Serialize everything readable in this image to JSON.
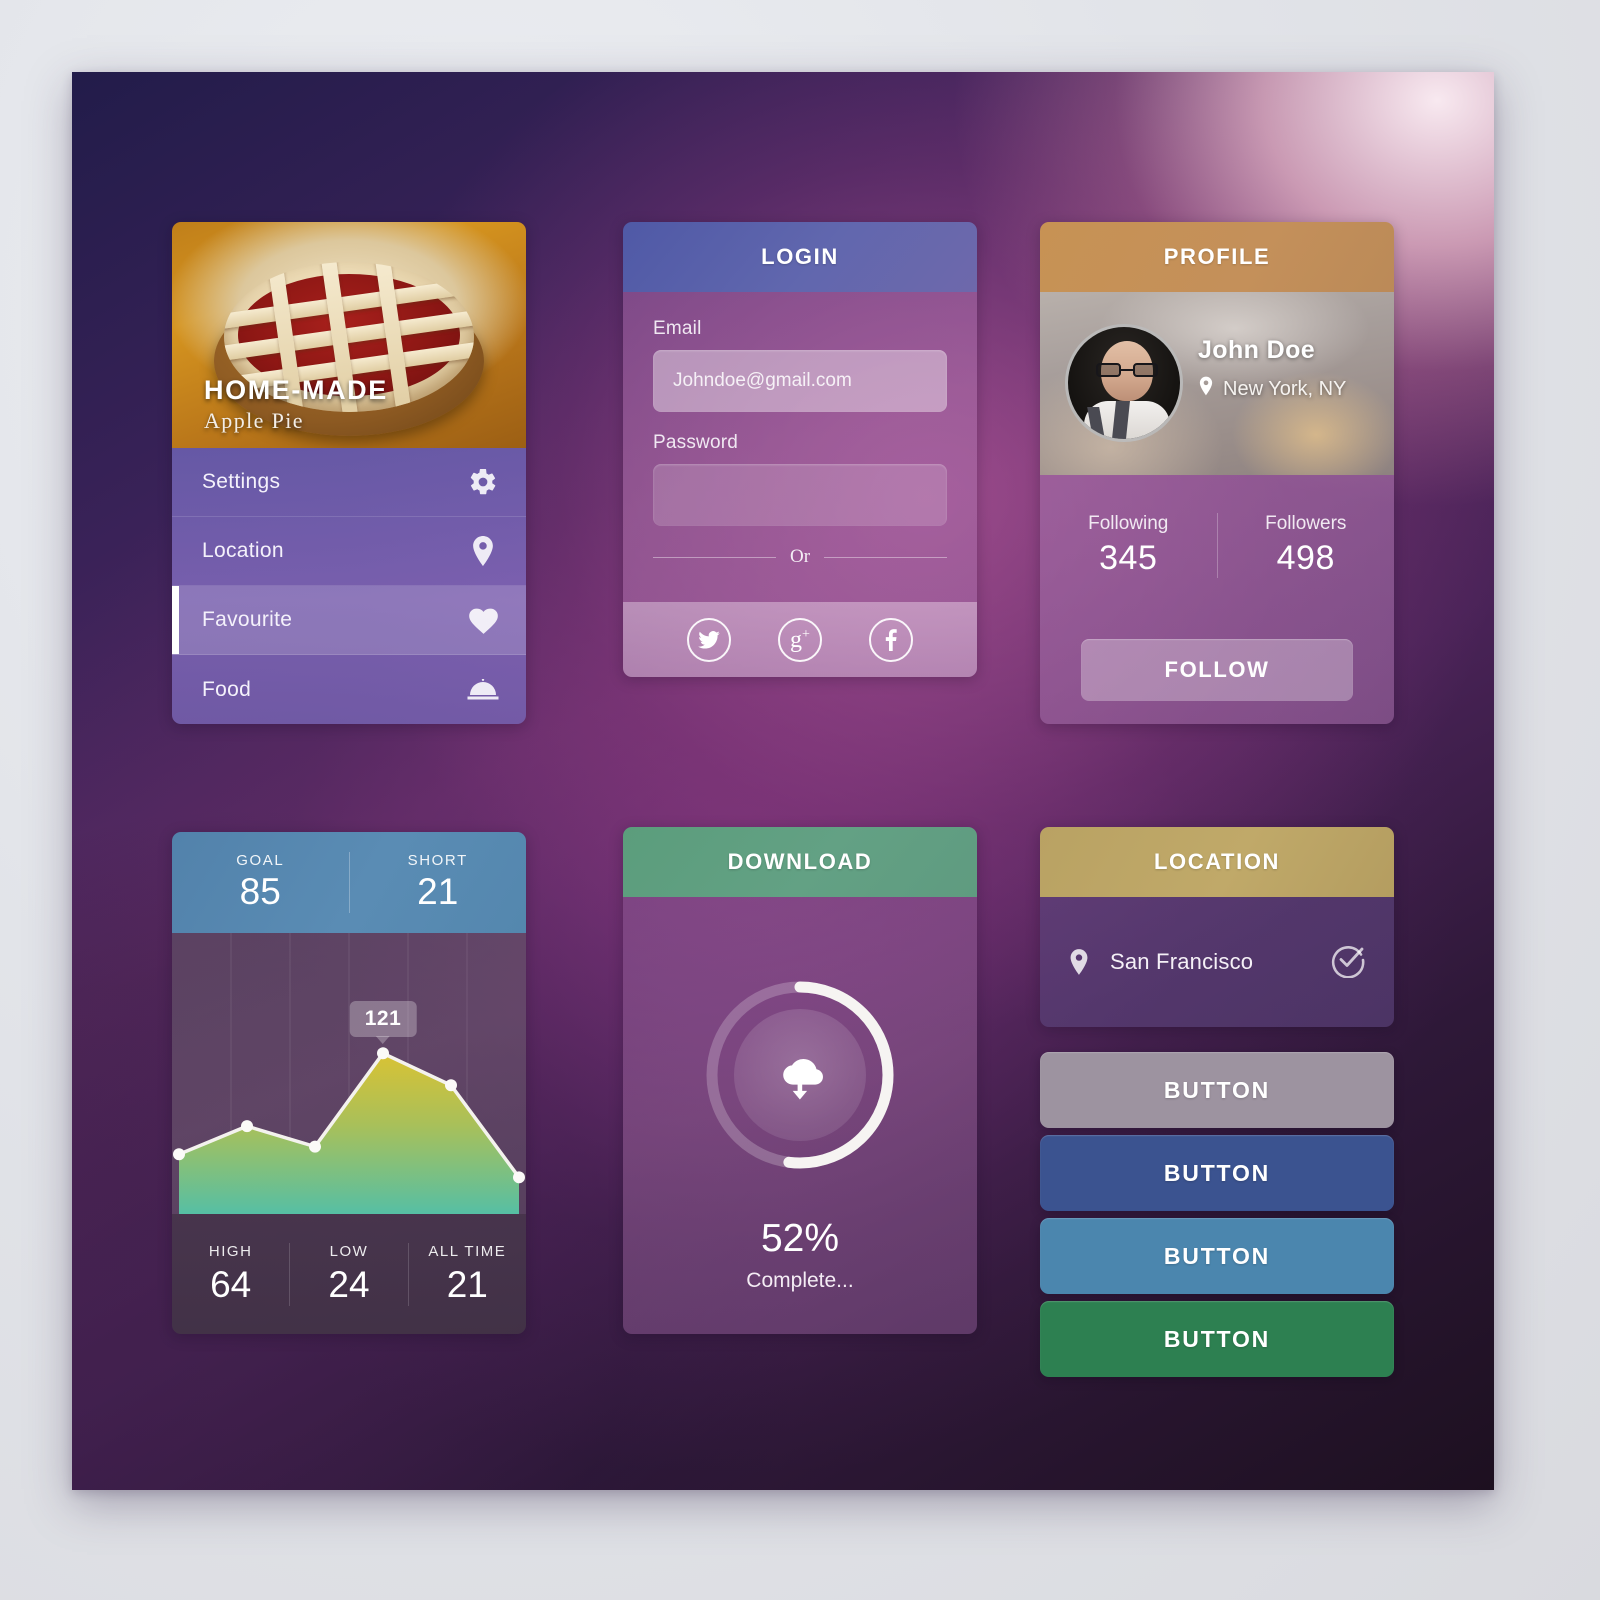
{
  "menu_card": {
    "hero": {
      "title": "HOME-MADE",
      "subtitle": "Apple Pie",
      "image_name": "apple-pie-photo"
    },
    "items": [
      {
        "label": "Settings",
        "icon": "gear-icon",
        "active": false
      },
      {
        "label": "Location",
        "icon": "map-pin-icon",
        "active": false
      },
      {
        "label": "Favourite",
        "icon": "heart-icon",
        "active": true
      },
      {
        "label": "Food",
        "icon": "food-cloche-icon",
        "active": false
      }
    ]
  },
  "login_card": {
    "title": "LOGIN",
    "email_label": "Email",
    "email_placeholder": "Johndoe@gmail.com",
    "password_label": "Password",
    "password_value": "",
    "divider_text": "Or",
    "social": [
      {
        "name": "twitter-icon",
        "label": "Twitter"
      },
      {
        "name": "googleplus-icon",
        "label": "Google Plus"
      },
      {
        "name": "facebook-icon",
        "label": "Facebook"
      }
    ],
    "header_color": "#5a60a8"
  },
  "profile_card": {
    "title": "PROFILE",
    "name": "John Doe",
    "location": "New York, NY",
    "avatar_name": "user-avatar-photo",
    "stats": [
      {
        "label": "Following",
        "value": "345"
      },
      {
        "label": "Followers",
        "value": "498"
      }
    ],
    "follow_label": "FOLLOW",
    "header_color": "#c49058"
  },
  "stats_card": {
    "top": [
      {
        "label": "GOAL",
        "value": "85"
      },
      {
        "label": "SHORT",
        "value": "21"
      }
    ],
    "tooltip": "121",
    "bottom": [
      {
        "label": "HIGH",
        "value": "64"
      },
      {
        "label": "LOW",
        "value": "24"
      },
      {
        "label": "ALL TIME",
        "value": "21"
      }
    ],
    "header_color": "#5687ae"
  },
  "download_card": {
    "title": "DOWNLOAD",
    "percent_label": "52%",
    "percent_value": 52,
    "status": "Complete...",
    "icon": "cloud-download-icon",
    "header_color": "#5f9f80"
  },
  "location_card": {
    "title": "LOCATION",
    "city": "San Francisco",
    "pin_icon": "map-pin-icon",
    "check_icon": "circle-check-icon",
    "header_color": "#b9a263"
  },
  "buttons": [
    {
      "label": "BUTTON",
      "color": "#9d93a0"
    },
    {
      "label": "BUTTON",
      "color": "#3b5390"
    },
    {
      "label": "BUTTON",
      "color": "#4b86ae"
    },
    {
      "label": "BUTTON",
      "color": "#2d8051"
    }
  ],
  "chart_data": {
    "type": "area",
    "title": "",
    "x": [
      0,
      1,
      2,
      3,
      4,
      5
    ],
    "values": [
      42,
      64,
      48,
      121,
      96,
      24
    ],
    "categories": [
      "",
      "",
      "",
      "",
      "",
      ""
    ],
    "highlight_index": 3,
    "highlight_label": "121",
    "ylim": [
      0,
      140
    ],
    "xlabel": "",
    "ylabel": "",
    "grid": true,
    "gridlines_x": 5,
    "legend": "none",
    "annotations": [
      {
        "label": "GOAL",
        "value": 85
      },
      {
        "label": "SHORT",
        "value": 21
      },
      {
        "label": "HIGH",
        "value": 64
      },
      {
        "label": "LOW",
        "value": 24
      },
      {
        "label": "ALL TIME",
        "value": 21
      }
    ],
    "fill_gradient": [
      "#d8c23c",
      "#5bbfa0"
    ],
    "line_color": "#ffffff"
  }
}
